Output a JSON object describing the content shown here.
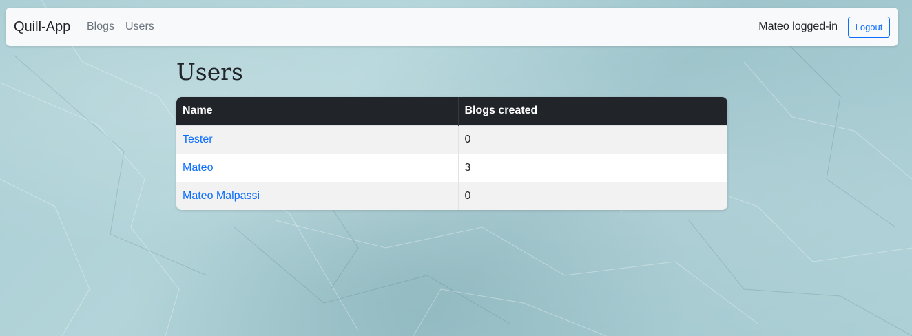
{
  "navbar": {
    "brand": "Quill-App",
    "links": [
      {
        "label": "Blogs"
      },
      {
        "label": "Users"
      }
    ],
    "login_status": "Mateo logged-in",
    "logout_label": "Logout"
  },
  "main": {
    "title": "Users",
    "table": {
      "headers": [
        "Name",
        "Blogs created"
      ],
      "rows": [
        {
          "name": "Tester",
          "blogs": "0"
        },
        {
          "name": "Mateo",
          "blogs": "3"
        },
        {
          "name": "Mateo Malpassi",
          "blogs": "0"
        }
      ]
    }
  },
  "colors": {
    "accent": "#0d6efd",
    "header_bg": "#212529",
    "navbar_bg": "#f8f9fa"
  }
}
